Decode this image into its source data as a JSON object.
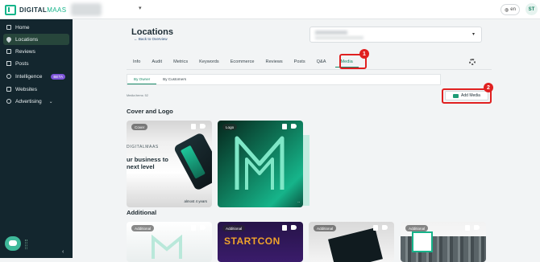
{
  "app": {
    "brand_main": "DIGITAL",
    "brand_accent": "MAAS",
    "language": "en",
    "user_initials": "ST",
    "accent_color": "#16b48a"
  },
  "sidebar": {
    "items": [
      {
        "label": "Home",
        "icon": "home-icon"
      },
      {
        "label": "Locations",
        "icon": "location-pin-icon",
        "active": true
      },
      {
        "label": "Reviews",
        "icon": "star-icon"
      },
      {
        "label": "Posts",
        "icon": "document-icon"
      },
      {
        "label": "Intelligence",
        "icon": "lightbulb-icon",
        "badge": "BETA"
      },
      {
        "label": "Websites",
        "icon": "globe-icon"
      },
      {
        "label": "Advertising",
        "icon": "megaphone-icon"
      }
    ]
  },
  "header": {
    "title": "Locations",
    "back_link": "← Back to Overview"
  },
  "tabs": [
    {
      "label": "Info"
    },
    {
      "label": "Audit"
    },
    {
      "label": "Metrics"
    },
    {
      "label": "Keywords"
    },
    {
      "label": "Ecommerce"
    },
    {
      "label": "Reviews"
    },
    {
      "label": "Posts"
    },
    {
      "label": "Q&A"
    },
    {
      "label": "Media",
      "active": true
    }
  ],
  "subtabs": [
    {
      "label": "By Owner",
      "active": true
    },
    {
      "label": "By Customers"
    }
  ],
  "media": {
    "count_label": "Media items: 52",
    "add_label": "Add Media"
  },
  "annotations": {
    "marker_1": "1",
    "marker_2": "2"
  },
  "sections": {
    "cover_title": "Cover and Logo",
    "additional_title": "Additional"
  },
  "cards": {
    "cover": {
      "badge": "Cover",
      "brand": "DIGITALMAAS",
      "headline_line1": "ur business to",
      "headline_line2": "next level",
      "age": "almost 4 years"
    },
    "logo": {
      "badge": "Logo"
    },
    "additional": [
      {
        "badge": "Additional"
      },
      {
        "badge": "Additional",
        "text": "STARTCON"
      },
      {
        "badge": "Additional"
      },
      {
        "badge": "Additional"
      }
    ]
  }
}
